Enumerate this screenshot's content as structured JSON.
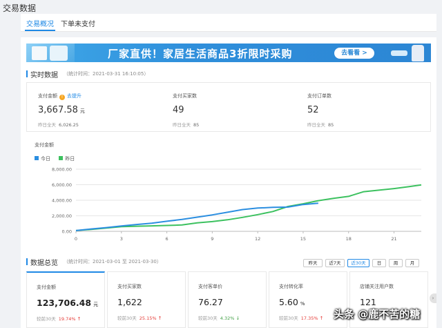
{
  "page_title": "交易数据",
  "tabs": [
    {
      "label": "交易概况"
    },
    {
      "label": "下单未支付"
    }
  ],
  "banner": {
    "text": "厂家直供！家居生活商品3折限时采购",
    "button_label": "去看看 >"
  },
  "realtime": {
    "title": "实时数据",
    "stat_time": "（统计时间：2021-03-31 16:10:05）",
    "yesterday_label": "昨日全天",
    "metrics": [
      {
        "label": "支付金额",
        "link": "去提升",
        "value": "3,667.58",
        "unit": "元",
        "yesterday": "6,026.25"
      },
      {
        "label": "支付买家数",
        "value": "49",
        "unit": "",
        "yesterday": "85"
      },
      {
        "label": "支付订单数",
        "value": "52",
        "unit": "",
        "yesterday": "85"
      }
    ]
  },
  "chart_data": {
    "type": "line",
    "title": "支付金额",
    "x_ticks": [
      0,
      3,
      6,
      9,
      12,
      15,
      18,
      21
    ],
    "xlim": [
      0,
      22.8
    ],
    "y_ticks": [
      "0.00",
      "2,000.00",
      "4,000.00",
      "6,000.00",
      "8,000.00"
    ],
    "ylim": [
      0,
      8000
    ],
    "grid": true,
    "legend_position": "top-left",
    "series": [
      {
        "name": "今日",
        "color": "#2b8ee0",
        "x": [
          0,
          1,
          2,
          3,
          4,
          5,
          6,
          7,
          8,
          9,
          10,
          11,
          12,
          13,
          14,
          15,
          16
        ],
        "y": [
          100,
          300,
          480,
          680,
          880,
          1050,
          1300,
          1530,
          1820,
          2120,
          2450,
          2800,
          3000,
          3080,
          3120,
          3450,
          3620
        ]
      },
      {
        "name": "昨日",
        "color": "#3cc15f",
        "x": [
          0,
          1,
          2,
          3,
          4,
          5,
          6,
          7,
          8,
          9,
          10,
          11,
          12,
          13,
          14,
          15,
          16,
          17,
          18,
          19,
          20,
          21,
          22,
          22.8
        ],
        "y": [
          100,
          250,
          420,
          600,
          660,
          700,
          760,
          820,
          1080,
          1250,
          1480,
          1800,
          2150,
          2550,
          3200,
          3550,
          3950,
          4250,
          4500,
          5100,
          5300,
          5500,
          5750,
          5980
        ]
      }
    ]
  },
  "summary": {
    "title": "数据总览",
    "stat_range": "（统计时间：2021-03-01 至 2021-03-30）",
    "range_buttons": [
      "昨天",
      "近7天",
      "近30天",
      "日",
      "周",
      "月"
    ],
    "active_range": "近30天",
    "compare_label": "较前30天",
    "cards": [
      {
        "label": "支付金额",
        "value": "123,706.48",
        "unit": "元",
        "pct": "19.74%",
        "trend": "up"
      },
      {
        "label": "支付买家数",
        "value": "1,622",
        "unit": "",
        "pct": "25.15%",
        "trend": "up"
      },
      {
        "label": "支付客单价",
        "value": "76.27",
        "unit": "",
        "pct": "4.32%",
        "trend": "down"
      },
      {
        "label": "支付转化率",
        "value": "5.60",
        "unit": "%",
        "pct": "17.35%",
        "trend": "up"
      },
      {
        "label": "店铺关注用户数",
        "value": "121",
        "unit": "",
        "pct": "",
        "trend": ""
      }
    ],
    "next_icon": "›"
  },
  "watermark": "头条 @鹿不苦的糖"
}
